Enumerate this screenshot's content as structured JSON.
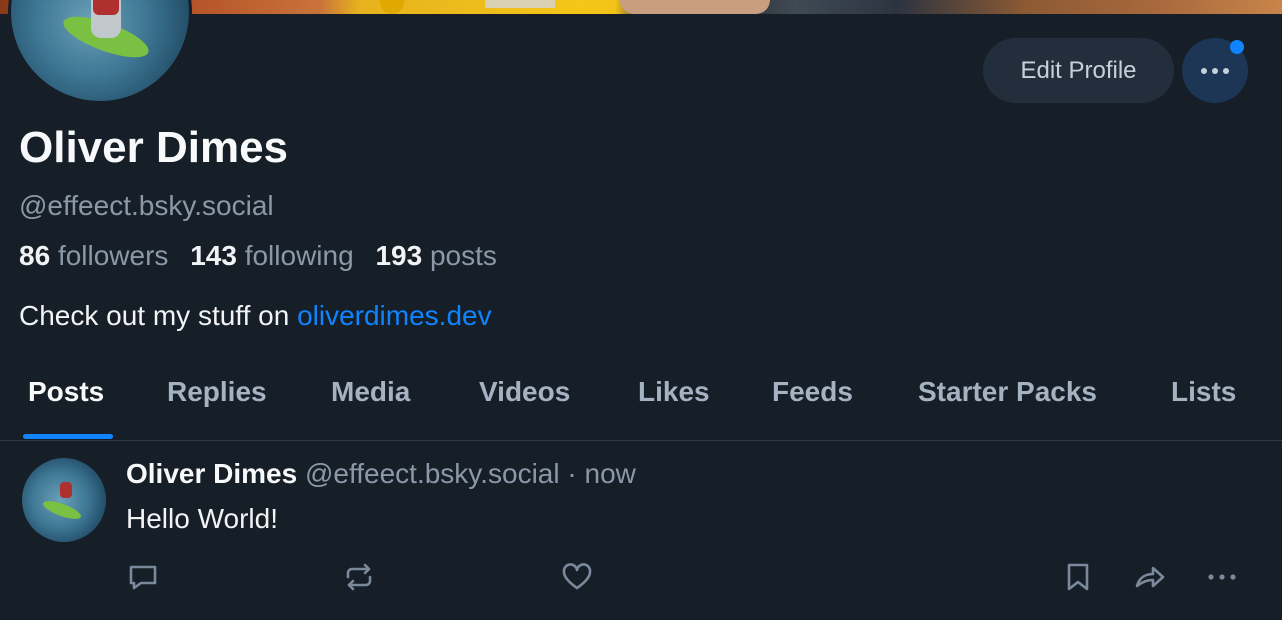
{
  "profile": {
    "name": "Oliver Dimes",
    "handle": "@effeect.bsky.social",
    "followers_count": "86",
    "followers_label": "followers",
    "following_count": "143",
    "following_label": "following",
    "posts_count": "193",
    "posts_label": "posts",
    "bio_text": "Check out my stuff on ",
    "bio_link": "oliverdimes.dev"
  },
  "actions": {
    "edit_label": "Edit Profile",
    "more_icon": "ellipsis-icon",
    "notification_color": "#1083fe"
  },
  "tabs": [
    {
      "label": "Posts",
      "active": true
    },
    {
      "label": "Replies"
    },
    {
      "label": "Media"
    },
    {
      "label": "Videos"
    },
    {
      "label": "Likes"
    },
    {
      "label": "Feeds"
    },
    {
      "label": "Starter Packs"
    },
    {
      "label": "Lists"
    }
  ],
  "post": {
    "author_name": "Oliver Dimes",
    "author_handle": "@effeect.bsky.social",
    "separator": "·",
    "time": "now",
    "text": "Hello World!",
    "icons": [
      "reply-icon",
      "repost-icon",
      "like-icon",
      "bookmark-icon",
      "share-icon",
      "more-icon"
    ]
  },
  "colors": {
    "background": "#161e27",
    "accent": "#1083fe",
    "muted_text": "#8a98a8"
  }
}
